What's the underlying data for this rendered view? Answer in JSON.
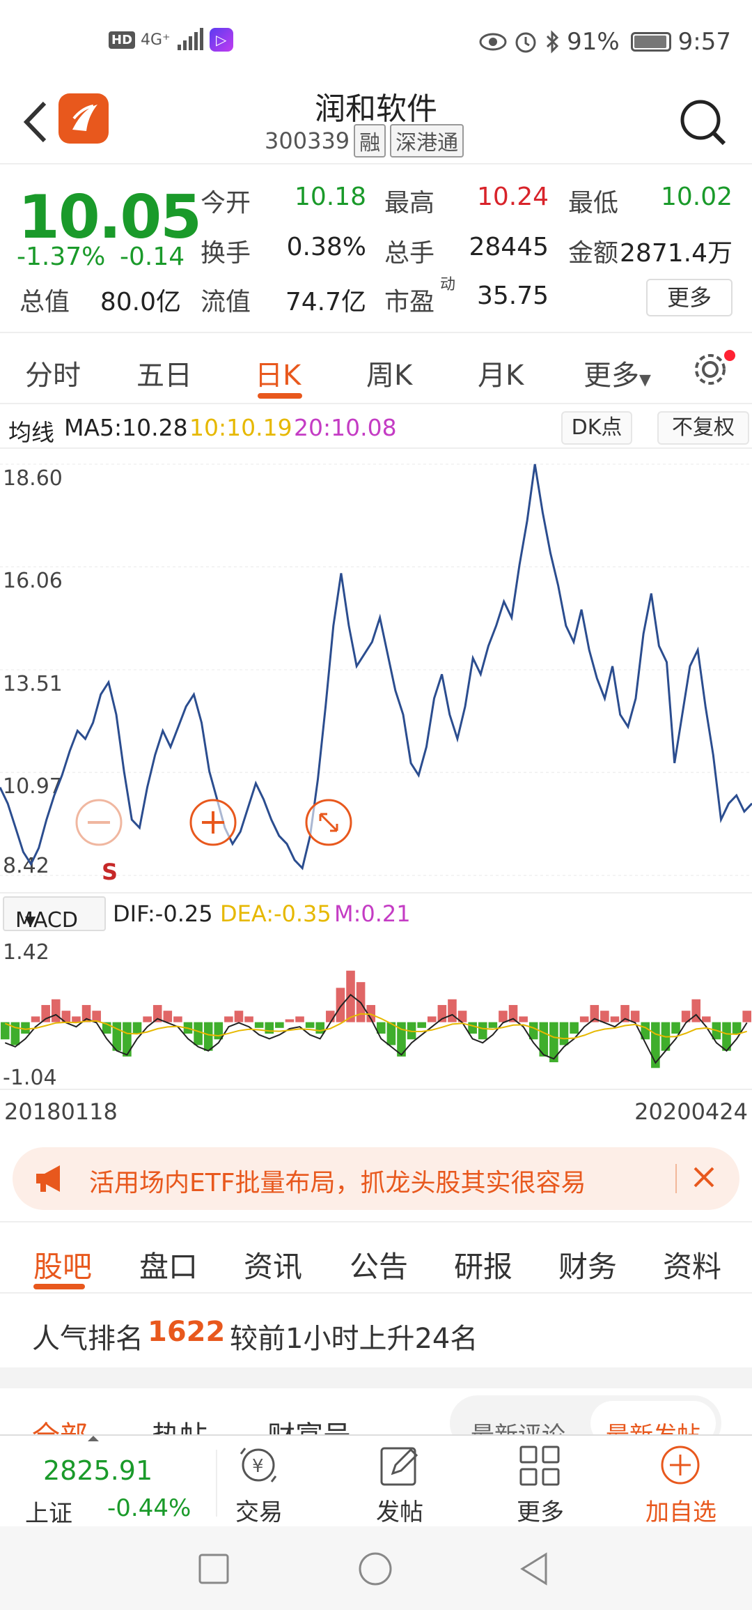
{
  "status_bar": {
    "hd": "HD",
    "network": "4G⁺",
    "battery": "91%",
    "time": "9:57"
  },
  "header": {
    "title": "润和软件",
    "code": "300339",
    "tag1": "融",
    "tag2": "深港通"
  },
  "quote": {
    "price": "10.05",
    "pct": "-1.37%",
    "change": "-0.14",
    "stats": [
      {
        "label": "今开",
        "value": "10.18",
        "color": "green"
      },
      {
        "label": "最高",
        "value": "10.24",
        "color": "red"
      },
      {
        "label": "最低",
        "value": "10.02",
        "color": "green"
      },
      {
        "label": "换手",
        "value": "0.38%",
        "color": "dark"
      },
      {
        "label": "总手",
        "value": "28445",
        "color": "dark"
      },
      {
        "label": "金额",
        "value": "2871.4万",
        "color": "dark"
      },
      {
        "label": "总值",
        "value": "80.0亿",
        "color": "dark"
      },
      {
        "label": "流值",
        "value": "74.7亿",
        "color": "dark"
      },
      {
        "label": "市盈",
        "value": "35.75",
        "color": "dark"
      }
    ],
    "pe_sup": "动",
    "more": "更多"
  },
  "ktabs": [
    "分时",
    "五日",
    "日K",
    "周K",
    "月K",
    "更多"
  ],
  "ma_legend": {
    "label": "均线",
    "ma5": "MA5:10.28",
    "ma10": "10:10.19",
    "ma20": "20:10.08",
    "dk": "DK点",
    "fq": "不复权"
  },
  "chart_data": [
    {
      "type": "line",
      "y_ticks": [
        "18.60",
        "16.06",
        "13.51",
        "10.97",
        "8.42"
      ],
      "ylim": [
        8.42,
        18.6
      ],
      "marker": "S",
      "x_start": "20180118",
      "x_end": "20200424",
      "values": [
        10.6,
        10.2,
        9.6,
        9.0,
        8.7,
        9.1,
        9.8,
        10.4,
        10.9,
        11.5,
        12.0,
        11.8,
        12.2,
        12.9,
        13.2,
        12.4,
        11.0,
        9.8,
        9.6,
        10.6,
        11.4,
        12.0,
        11.6,
        12.1,
        12.6,
        12.9,
        12.2,
        11.0,
        10.3,
        9.6,
        9.2,
        9.5,
        10.1,
        10.7,
        10.3,
        9.8,
        9.4,
        9.2,
        8.8,
        8.6,
        9.4,
        10.8,
        12.6,
        14.6,
        15.9,
        14.6,
        13.6,
        13.9,
        14.2,
        14.8,
        13.9,
        13.0,
        12.4,
        11.2,
        10.9,
        11.6,
        12.8,
        13.4,
        12.4,
        11.8,
        12.6,
        13.8,
        13.4,
        14.1,
        14.6,
        15.2,
        14.8,
        16.1,
        17.2,
        18.6,
        17.4,
        16.4,
        15.6,
        14.6,
        14.2,
        15.0,
        14.0,
        13.3,
        12.8,
        13.6,
        12.4,
        12.1,
        12.8,
        14.4,
        15.4,
        14.1,
        13.7,
        11.2,
        12.4,
        13.6,
        14.0,
        12.6,
        11.4,
        9.8,
        10.2,
        10.4,
        10.0,
        10.2
      ],
      "series_name": "close"
    },
    {
      "type": "bar",
      "title": "MACD",
      "y_ticks": [
        "1.42",
        "-1.04"
      ],
      "ylim": [
        -1.04,
        1.42
      ],
      "dif": "DIF:-0.25",
      "dea": "DEA:-0.35",
      "m": "M:0.21",
      "values": [
        -0.3,
        -0.4,
        -0.2,
        0.1,
        0.3,
        0.4,
        0.2,
        0.1,
        0.3,
        0.2,
        -0.2,
        -0.5,
        -0.6,
        -0.2,
        0.1,
        0.3,
        0.2,
        0.1,
        -0.2,
        -0.4,
        -0.5,
        -0.3,
        0.1,
        0.2,
        0.1,
        -0.1,
        -0.2,
        -0.1,
        0.05,
        0.1,
        -0.1,
        -0.2,
        0.2,
        0.6,
        0.9,
        0.7,
        0.3,
        -0.2,
        -0.4,
        -0.6,
        -0.3,
        -0.1,
        0.1,
        0.3,
        0.4,
        0.2,
        -0.2,
        -0.3,
        -0.1,
        0.2,
        0.3,
        0.1,
        -0.3,
        -0.6,
        -0.7,
        -0.4,
        -0.2,
        0.1,
        0.3,
        0.2,
        0.1,
        0.3,
        0.2,
        -0.3,
        -0.8,
        -0.5,
        -0.2,
        0.2,
        0.4,
        0.1,
        -0.3,
        -0.5,
        -0.2,
        0.2
      ]
    }
  ],
  "banner": {
    "text": "活用场内ETF批量布局，抓龙头股其实很容易"
  },
  "section_tabs": [
    "股吧",
    "盘口",
    "资讯",
    "公告",
    "研报",
    "财务",
    "资料"
  ],
  "rank": {
    "label": "人气排名",
    "value": "1622",
    "desc": "较前1小时上升24名"
  },
  "peek": {
    "t1": "全部",
    "t2": "热帖",
    "t3": "财富号",
    "p1": "最新评论",
    "p2": "最新发帖"
  },
  "bottom_bar": {
    "index_value": "2825.91",
    "index_name": "上证",
    "index_pct": "-0.44%",
    "trade": "交易",
    "post": "发帖",
    "more": "更多",
    "add": "加自选"
  },
  "colors": {
    "accent": "#e8581d",
    "up": "#d8232a",
    "down": "#1a9a2a",
    "line": "#2b4d8f"
  }
}
